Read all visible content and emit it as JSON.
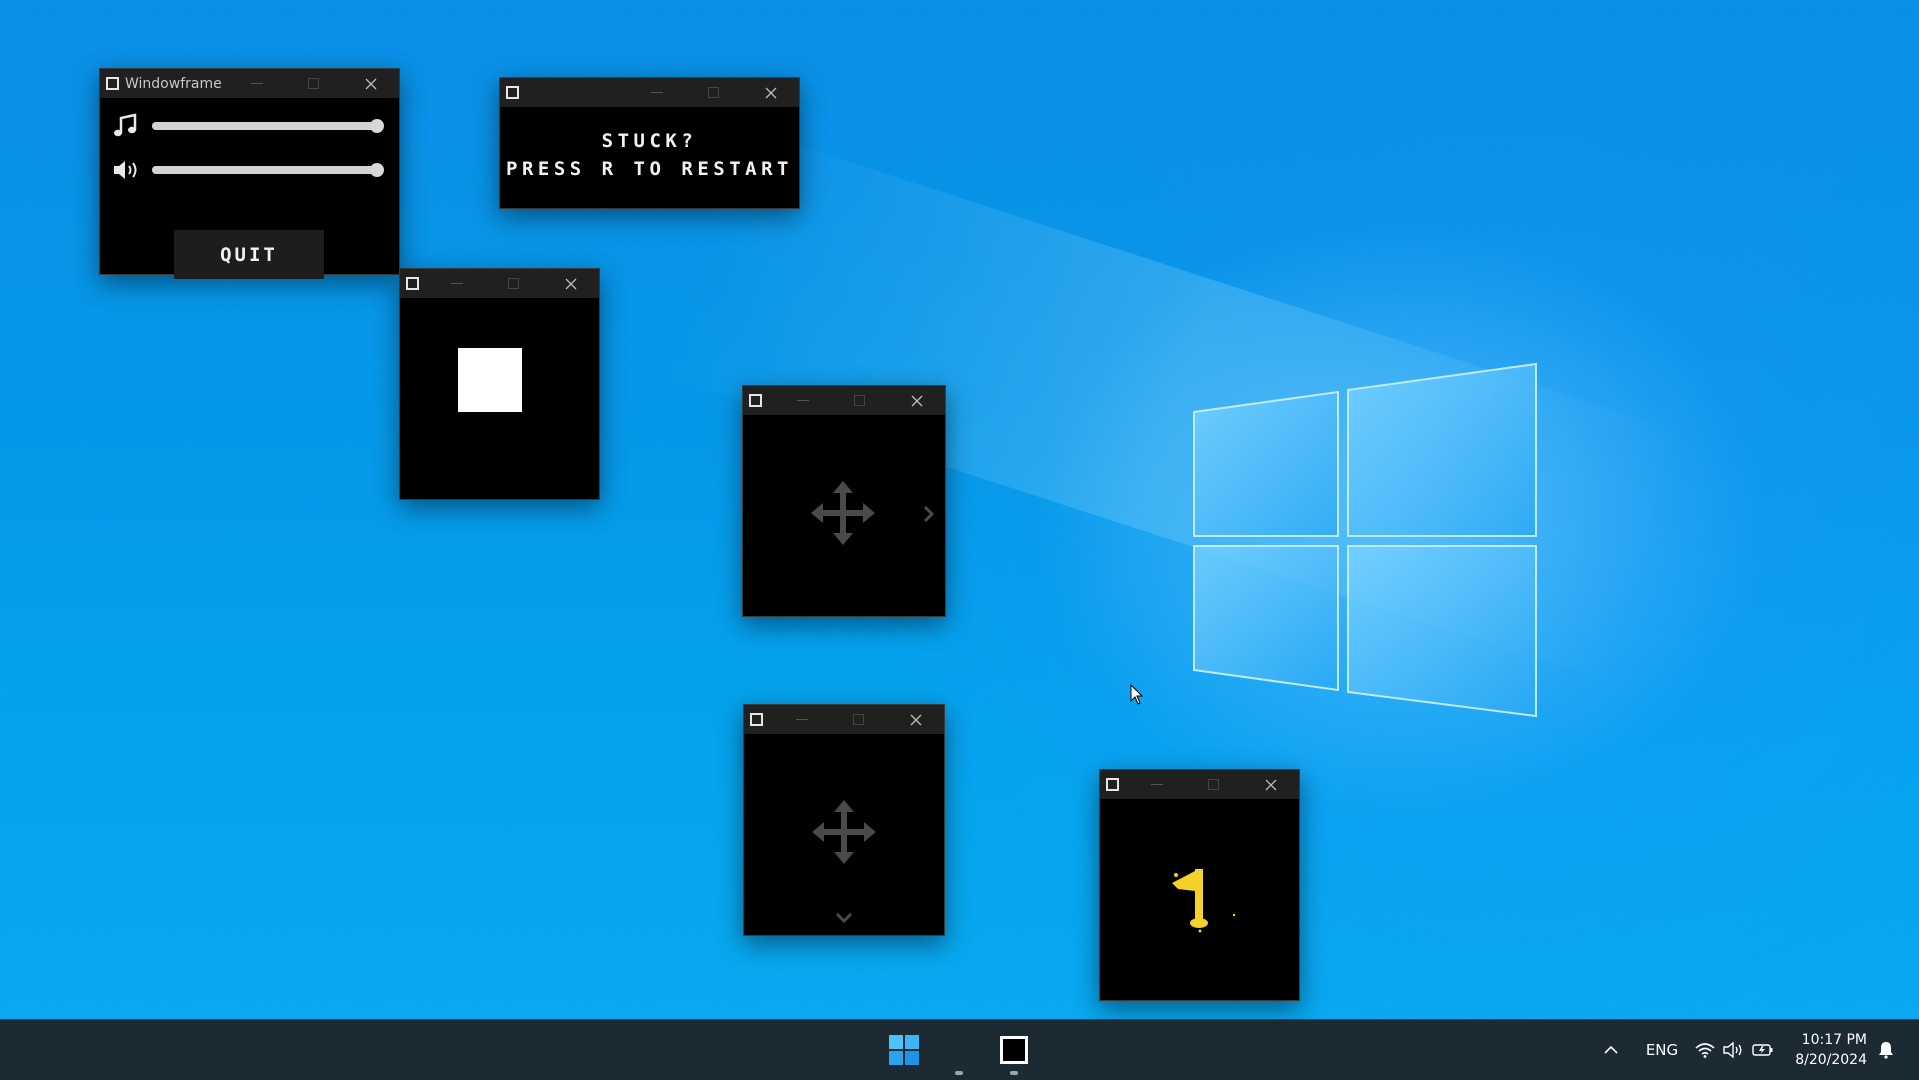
{
  "windows": {
    "settings": {
      "title": "Windowframe",
      "music_icon": "music-note-icon",
      "sound_icon": "speaker-volume-icon",
      "music_volume": 1.0,
      "sound_volume": 1.0,
      "quit_label": "QUIT"
    },
    "hint": {
      "line1": "STUCK?",
      "line2": "PRESS R TO RESTART"
    },
    "player": {
      "icon": "white-square-player"
    },
    "move_right": {
      "icon": "move-arrows-icon",
      "hint_icon": "chevron-right-icon"
    },
    "move_down": {
      "icon": "move-arrows-icon",
      "hint_icon": "chevron-down-icon"
    },
    "goal": {
      "icon": "yellow-flag-icon"
    }
  },
  "taskbar": {
    "start_icon": "windows-start-icon",
    "app_icon": "windowframe-app-icon",
    "tray": {
      "chevron_icon": "chevron-up-icon",
      "language": "ENG",
      "wifi_icon": "wifi-icon",
      "volume_icon": "volume-icon",
      "battery_icon": "battery-icon",
      "time": "10:17 PM",
      "date": "8/20/2024",
      "notification_icon": "bell-icon"
    }
  },
  "colors": {
    "desktop": "#0a98ea",
    "window_bg": "#000000",
    "titlebar": "#202020",
    "taskbar": "#1b2a33",
    "flag": "#f5cf2a"
  }
}
